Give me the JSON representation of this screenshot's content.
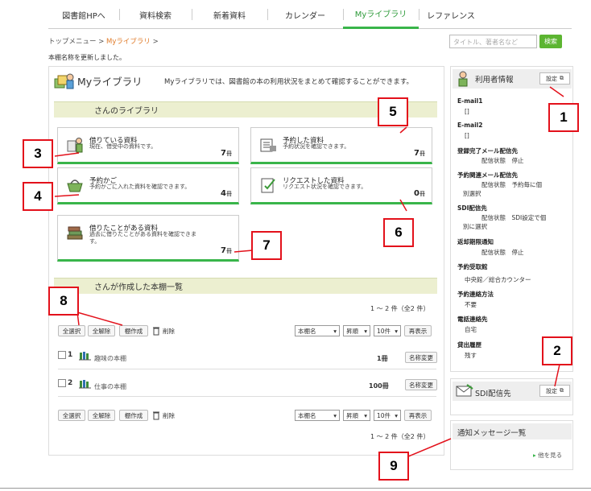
{
  "nav": {
    "tabs": [
      "図書館HPへ",
      "資料検索",
      "新着資料",
      "カレンダー",
      "Myライブラリ",
      "レファレンス"
    ]
  },
  "breadcrumb": {
    "top": "トップメニュー >",
    "current": "Myライブラリ",
    "sep": ">"
  },
  "search": {
    "placeholder": "タイトル、著者名など",
    "button": "検索"
  },
  "notice": "本棚名称を更新しました。",
  "mylib": {
    "title": "Myライブラリ",
    "desc": "Myライブラリでは、図書館の本の利用状況をまとめて確認することができます。"
  },
  "library_section": "さんのライブラリ",
  "cards": [
    {
      "title": "借りている資料",
      "desc": "現在、借受中の資料です。",
      "count": "7",
      "unit": "冊"
    },
    {
      "title": "予約した資料",
      "desc": "予約状況を確認できます。",
      "count": "7",
      "unit": "冊"
    },
    {
      "title": "予約かご",
      "desc": "予約かごに入れた資料を確認できます。",
      "count": "4",
      "unit": "冊"
    },
    {
      "title": "リクエストした資料",
      "desc": "リクエスト状況を確認できます。",
      "count": "0",
      "unit": "冊"
    },
    {
      "title": "借りたことがある資料",
      "desc": "過去に借りたことがある資料を確認できます。",
      "count": "7",
      "unit": "冊"
    }
  ],
  "shelf_section": "さんが作成した本棚一覧",
  "pager": "1 ～ 2 件（全2 件）",
  "toolbar": {
    "select_all": "全選択",
    "deselect_all": "全解除",
    "create": "棚作成",
    "delete": "削除",
    "sort_key": "本棚名",
    "order": "昇順",
    "per_page": "10件",
    "show": "再表示"
  },
  "shelves": [
    {
      "no": "1",
      "name": "趣味の本棚",
      "count": "1冊",
      "rename": "名称変更"
    },
    {
      "no": "2",
      "name": "仕事の本棚",
      "count": "100冊",
      "rename": "名称変更"
    }
  ],
  "side": {
    "user_info": "利用者情報",
    "settings": "設定",
    "email1": "E-mail1",
    "email1_val": "[]",
    "email2": "E-mail2",
    "email2_val": "[]",
    "reg_mail": "登録完了メール配信先",
    "reg_mail_val": "配信状態　停止",
    "res_mail": "予約関連メール配信先",
    "res_mail_val1": "配信状態　予約毎に個",
    "res_mail_val2": "別選択",
    "sdi": "SDI配信先",
    "sdi_val1": "配信状態　SDI設定で個",
    "sdi_val2": "別に選択",
    "overdue": "返却期限通知",
    "overdue_val": "配信状態　停止",
    "pickup": "予約受取館",
    "pickup_val": "中央館／総合カウンター",
    "contact": "予約連絡方法",
    "contact_val": "不要",
    "phone": "電話連絡先",
    "phone_val": "自宅",
    "history": "貸出履歴",
    "history_val": "残す",
    "sdi_box": "SDI配信先",
    "messages": "通知メッセージ一覧",
    "more": "他を見る"
  },
  "callouts": [
    "1",
    "2",
    "3",
    "4",
    "5",
    "6",
    "7",
    "8",
    "9"
  ],
  "colors": {
    "accent": "#39b54a",
    "callout": "#e3111b",
    "section": "#ecefd0"
  }
}
